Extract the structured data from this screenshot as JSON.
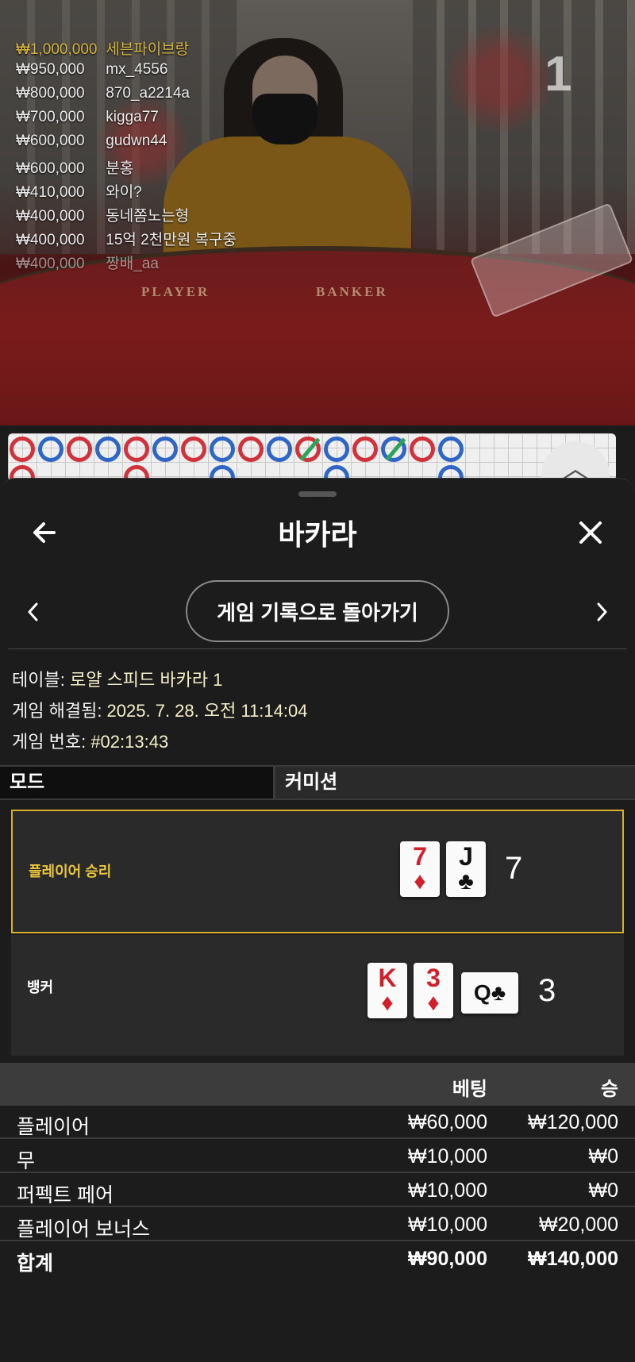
{
  "video": {
    "round_number": "1",
    "table_labels": {
      "player": "PLAYER",
      "banker": "BANKER"
    },
    "leaderboard": [
      {
        "amount": "₩1,000,000",
        "name": "세븐파이브랑"
      },
      {
        "amount": "₩950,000",
        "name": "mx_4556"
      },
      {
        "amount": "₩800,000",
        "name": "870_a2214a"
      },
      {
        "amount": "₩700,000",
        "name": "kigga77"
      },
      {
        "amount": "₩600,000",
        "name": "gudwn44"
      },
      {
        "amount": "₩600,000",
        "name": "분홍"
      },
      {
        "amount": "₩410,000",
        "name": "와이?"
      },
      {
        "amount": "₩400,000",
        "name": "동네쫌노는형"
      },
      {
        "amount": "₩400,000",
        "name": "15억 2천만원 복구중"
      },
      {
        "amount": "₩400,000",
        "name": "짱배_aa"
      }
    ]
  },
  "scroll_top": {
    "icon": "chevron-up-icon",
    "glyph": "︿"
  },
  "header": {
    "title": "바카라",
    "back_icon": "arrow-left-icon",
    "close_icon": "close-icon"
  },
  "nav": {
    "back_to_history_label": "게임 기록으로 돌아가기",
    "prev_icon": "chevron-left-icon",
    "next_icon": "chevron-right-icon"
  },
  "info": {
    "table_label": "테이블: ",
    "table_value": "로얄 스피드 바카라 1",
    "resolved_label": "게임 해결됨: ",
    "resolved_value": "2025. 7. 28. 오전 11:14:04",
    "game_no_label": "게임 번호: ",
    "game_no_value": "#02:13:43"
  },
  "mode": {
    "mode_label": "모드",
    "mode_value": "커미션"
  },
  "hands": {
    "player": {
      "label": "플레이어 승리",
      "score": "7",
      "cards": [
        {
          "rank": "7",
          "suit": "♦"
        },
        {
          "rank": "J",
          "suit": "♣"
        }
      ]
    },
    "banker": {
      "label": "뱅커",
      "score": "3",
      "cards": [
        {
          "rank": "K",
          "suit": "♦"
        },
        {
          "rank": "3",
          "suit": "♦"
        },
        {
          "rank": "Q",
          "suit": "♣"
        }
      ]
    }
  },
  "bets": {
    "header": {
      "bet": "베팅",
      "win": "승"
    },
    "rows": [
      {
        "name": "플레이어",
        "bet": "₩60,000",
        "win": "₩120,000"
      },
      {
        "name": "무",
        "bet": "₩10,000",
        "win": "₩0"
      },
      {
        "name": "퍼펙트 페어",
        "bet": "₩10,000",
        "win": "₩0"
      },
      {
        "name": "플레이어 보너스",
        "bet": "₩10,000",
        "win": "₩20,000"
      }
    ],
    "total": {
      "name": "합계",
      "bet": "₩90,000",
      "win": "₩140,000"
    }
  },
  "colors": {
    "accent_gold": "#e9c53c",
    "value_cream": "#f5efc7",
    "card_red": "#d31f2a",
    "bead_red": "#d0333c",
    "bead_blue": "#2f66c6",
    "tie_green": "#2fa35a"
  }
}
